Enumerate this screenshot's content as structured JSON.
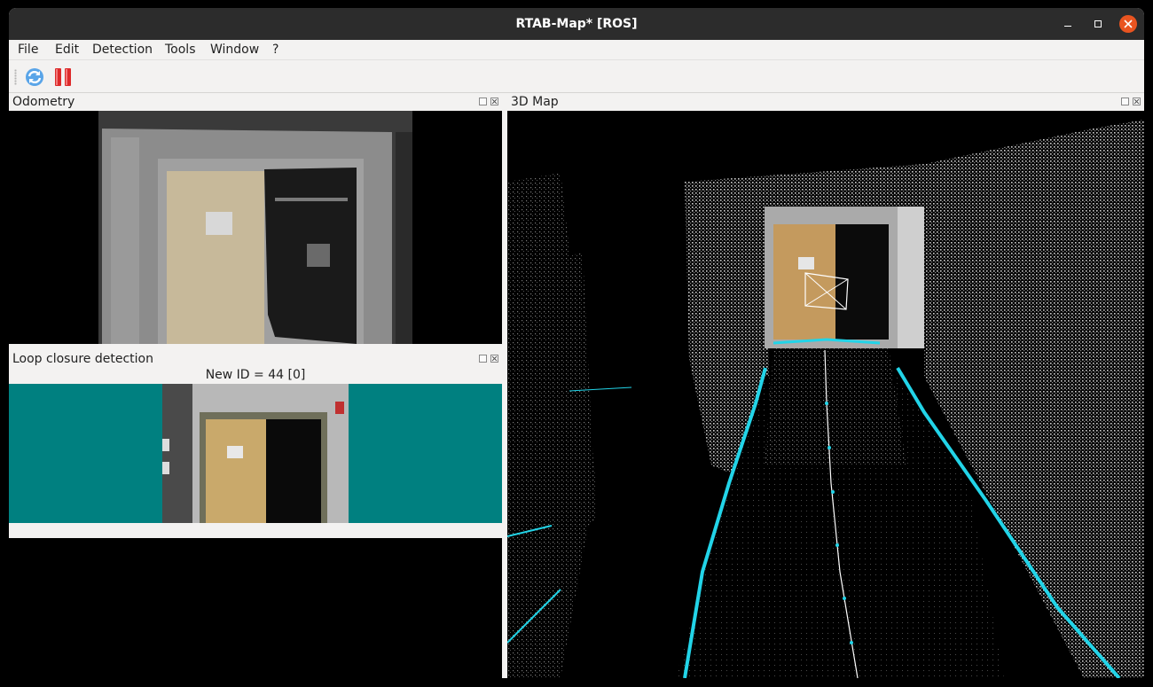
{
  "window": {
    "title": "RTAB-Map* [ROS]",
    "close_color": "#e95420"
  },
  "menu": {
    "items": [
      "File",
      "Edit",
      "Detection",
      "Tools",
      "Window",
      "?"
    ]
  },
  "toolbar": {
    "buttons": [
      {
        "name": "refresh-icon",
        "color": "#2a7fcf"
      },
      {
        "name": "pause-icon",
        "color": "#dd2a2a"
      }
    ]
  },
  "docks": {
    "odometry": {
      "title": "Odometry"
    },
    "loop_closure": {
      "title": "Loop closure detection",
      "caption": "New ID = 44 [0]"
    },
    "map3d": {
      "title": "3D Map"
    }
  },
  "colors": {
    "loop_background": "#008080",
    "trajectory": "#22d4e8"
  }
}
